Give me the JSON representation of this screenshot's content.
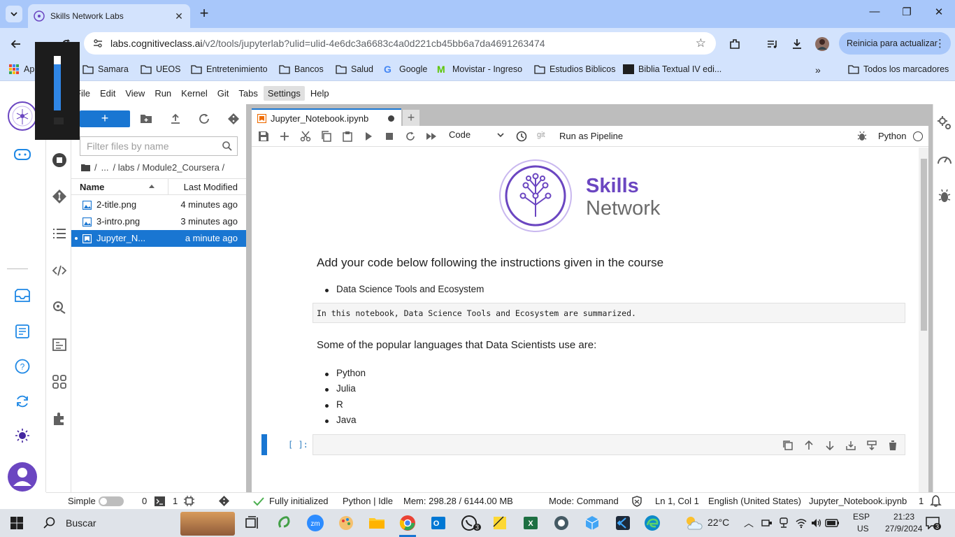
{
  "browser": {
    "tab_title": "Skills Network Labs",
    "url_host": "labs.cognitiveclass.ai",
    "url_path": "/v2/tools/jupyterlab?ulid=ulid-4e6dc3a6683c4a0d221cb45bb6a7da4691263474",
    "update_label": "Reinicia para actualizar",
    "bookmarks": [
      "Ap",
      "Samara",
      "UEOS",
      "Entretenimiento",
      "Bancos",
      "Salud",
      "Google",
      "Movistar - Ingreso",
      "Estudios Biblicos",
      "Biblia Textual IV edi...",
      "Todos los marcadores"
    ]
  },
  "menubar": [
    "File",
    "Edit",
    "View",
    "Run",
    "Kernel",
    "Git",
    "Tabs",
    "Settings",
    "Help"
  ],
  "filebrowser": {
    "new_label": "+",
    "filter_placeholder": "Filter files by name",
    "crumbs": [
      "/",
      "...",
      "/ labs / Module2_Coursera /"
    ],
    "col_name": "Name",
    "col_modified": "Last Modified",
    "files": [
      {
        "name": "2-title.png",
        "modified": "4 minutes ago"
      },
      {
        "name": "3-intro.png",
        "modified": "3 minutes ago"
      },
      {
        "name": "Jupyter_N...",
        "modified": "a minute ago"
      }
    ]
  },
  "notebook": {
    "tab_title": "Jupyter_Notebook.ipynb",
    "cell_type": "Code",
    "git_label": "git",
    "pipeline_label": "Run as Pipeline",
    "kernel": "Python",
    "logo_line1": "Skills",
    "logo_line2": "Network",
    "heading": "Add your code below following the instructions given in the course",
    "bullet1": "Data Science Tools and Ecosystem",
    "raw_text": "In this notebook, Data Science Tools and Ecosystem are summarized.",
    "paragraph": "Some of the popular languages that Data Scientists use are:",
    "languages": [
      "Python",
      "Julia",
      "R",
      "Java"
    ],
    "prompt": "[ ]:"
  },
  "statusbar": {
    "mode_simple": "Simple",
    "count1": "0",
    "count2": "1",
    "initialized": "Fully initialized",
    "kernel_state": "Python | Idle",
    "mem": "Mem: 298.28 / 6144.00 MB",
    "mode": "Mode: Command",
    "position": "Ln 1, Col 1",
    "language": "English (United States)",
    "file": "Jupyter_Notebook.ipynb",
    "notifications": "1"
  },
  "taskbar": {
    "search": "Buscar",
    "weather": "22°C",
    "lang1": "ESP",
    "lang2": "US",
    "time": "21:23",
    "date": "27/9/2024",
    "notif_count": "3",
    "whatsapp_badge": "3"
  },
  "colors": {
    "accent": "#1976d2",
    "brand_purple": "#6b46c1",
    "chrome_bg": "#d3e3fd"
  }
}
